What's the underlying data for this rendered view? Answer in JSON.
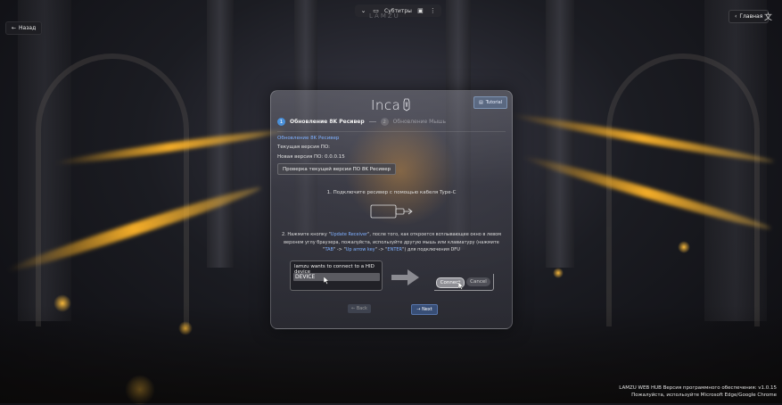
{
  "toolbar": {
    "subtitles_label": "Субтитры",
    "brand_watermark": "LAMZU"
  },
  "nav": {
    "back_label": "Назад",
    "home_label": "Главная",
    "translate_icon": "translate-icon"
  },
  "dialog": {
    "logo_text": "Inca",
    "tutorial_label": "Tutorial",
    "steps": [
      {
        "number": "1",
        "label": "Обновление 8K Ресивер",
        "active": true
      },
      {
        "number": "2",
        "label": "Обновление Мышь",
        "active": false
      }
    ],
    "section_title": "Обновление 8K Ресивер",
    "current_version_label": "Текущая версия ПО:",
    "new_version_label": "Новая версия ПО: 0.0.0.15",
    "check_button_label": "Проверка текущей версии ПО 8K Ресивер",
    "instruction_1": "1. Подключите ресивер с помощью кабеля Type-C",
    "instruction_2": {
      "prefix": "2. Нажмите кнопку \"",
      "update_receiver": "Update Receiver",
      "middle": "\", после того, как откроется всплывающее окно в левом верхнем углу браузера, пожалуйста, используйте другую мышь или клавиатуру (нажмите \"",
      "tab": "TAB",
      "arrow1": "\" -> \"",
      "up_arrow": "Up arrow key",
      "arrow2": "\" -> \"",
      "enter": "ENTER",
      "suffix": "\") для подключения DFU"
    },
    "hid_prompt": {
      "text": "lamzu wants to connect to a HID device",
      "device": "DEVICE"
    },
    "connect_label": "Connect",
    "cancel_label": "Cancel",
    "prev_label": "Back",
    "next_label": "Next"
  },
  "footer": {
    "version_line": "LAMZU WEB HUB Версия программного обеспечения: v1.0.15",
    "browser_line": "Пожалуйста, используйте Microsoft Edge/Google Chrome"
  },
  "colors": {
    "accent": "#4a90d9",
    "highlight_text": "#7fb0ff",
    "glow": "#ffb428"
  }
}
